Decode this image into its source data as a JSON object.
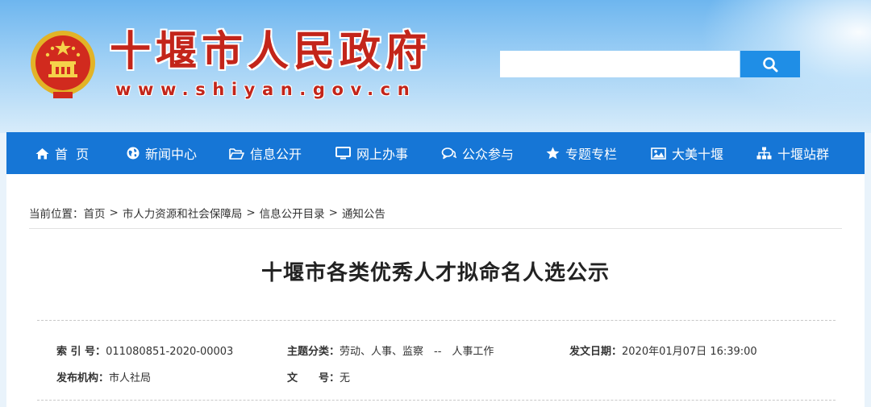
{
  "header": {
    "site_title": "十堰市人民政府",
    "site_url": "www.shiyan.gov.cn",
    "search": {
      "placeholder": ""
    }
  },
  "nav": {
    "items": [
      {
        "label": "首  页",
        "icon": "home-icon"
      },
      {
        "label": "新闻中心",
        "icon": "globe-icon"
      },
      {
        "label": "信息公开",
        "icon": "folder-open-icon"
      },
      {
        "label": "网上办事",
        "icon": "monitor-icon"
      },
      {
        "label": "公众参与",
        "icon": "chat-icon"
      },
      {
        "label": "专题专栏",
        "icon": "star-icon"
      },
      {
        "label": "大美十堰",
        "icon": "image-icon"
      },
      {
        "label": "十堰站群",
        "icon": "sitemap-icon"
      }
    ]
  },
  "breadcrumb": {
    "prefix": "当前位置：",
    "items": [
      "首页",
      "市人力资源和社会保障局",
      "信息公开目录",
      "通知公告"
    ],
    "separator": ">"
  },
  "article": {
    "title": "十堰市各类优秀人才拟命名人选公示"
  },
  "meta": {
    "index_label": "索 引 号：",
    "index_value": "011080851-2020-00003",
    "category_label": "主题分类：",
    "category_value": "劳动、人事、监察　--　人事工作",
    "date_label": "发文日期：",
    "date_value": "2020年01月07日 16:39:00",
    "publisher_label": "发布机构：",
    "publisher_value": "市人社局",
    "docno_label": "文　　号：",
    "docno_value": "无"
  },
  "colors": {
    "brand_red": "#c3251a",
    "nav_blue": "#1676d6",
    "search_blue": "#1f8ee6"
  }
}
